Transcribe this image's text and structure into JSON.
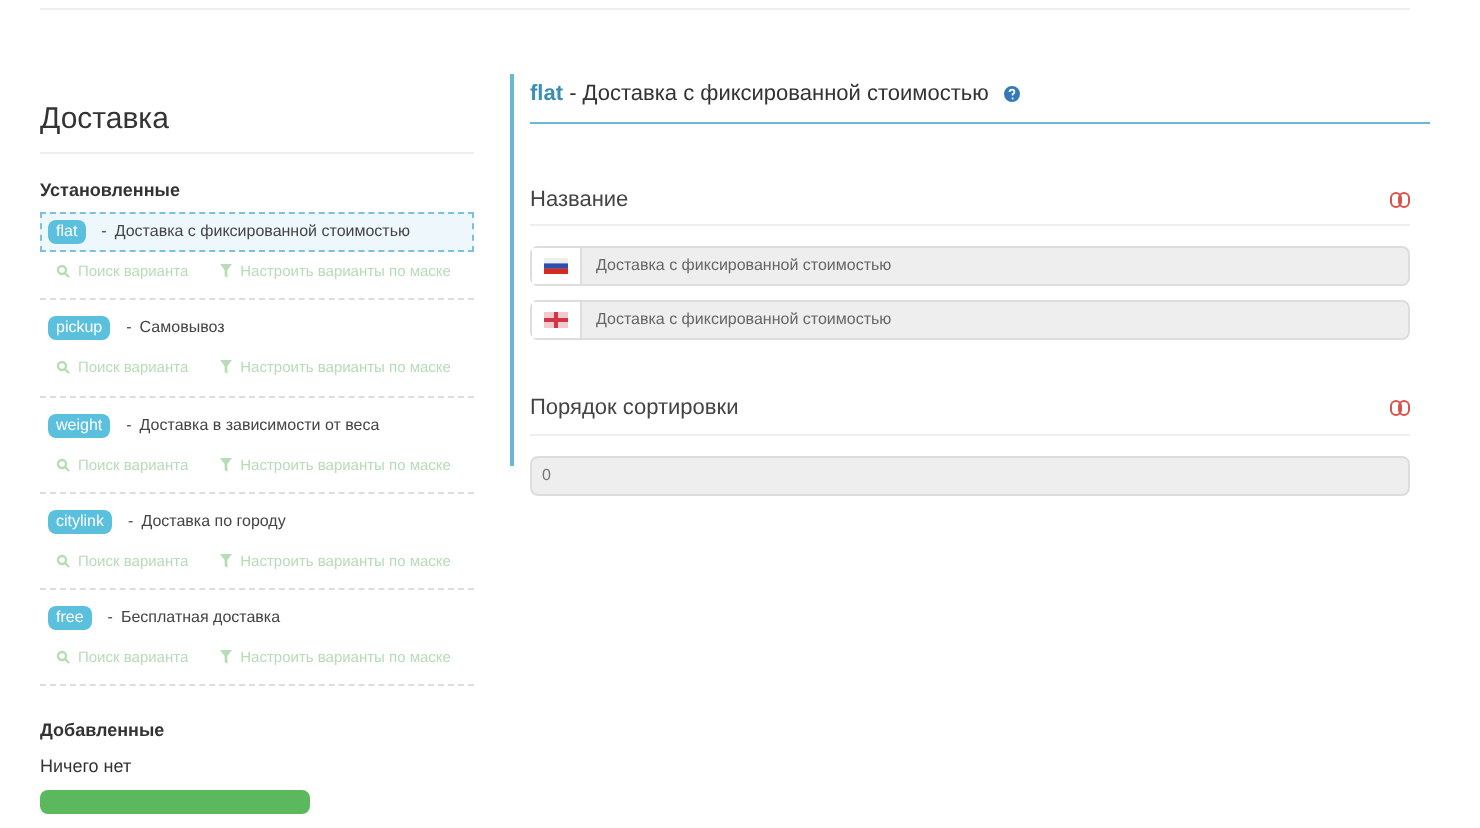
{
  "sidebar": {
    "title": "Доставка",
    "installed": {
      "heading": "Установленные",
      "items": [
        {
          "code": "flat",
          "separator": "-",
          "name": "Доставка с фиксированной стоимостью",
          "selected": true,
          "links": [
            "Поиск варианта",
            "Настроить варианты по маске"
          ]
        },
        {
          "code": "pickup",
          "separator": "-",
          "name": "Самовывоз",
          "selected": false,
          "links": [
            "Поиск варианта",
            "Настроить варианты по маске"
          ]
        },
        {
          "code": "weight",
          "separator": "-",
          "name": "Доставка в зависимости от веса",
          "selected": false,
          "links": [
            "Поиск варианта",
            "Настроить варианты по маске"
          ]
        },
        {
          "code": "citylink",
          "separator": "-",
          "name": "Доставка по городу",
          "selected": false,
          "links": [
            "Поиск варианта",
            "Настроить варианты по маске"
          ]
        },
        {
          "code": "free",
          "separator": "-",
          "name": "Бесплатная доставка",
          "selected": false,
          "links": [
            "Поиск варианта",
            "Настроить варианты по маске"
          ]
        }
      ]
    },
    "added": {
      "heading": "Добавленные",
      "empty_text": "Ничего нет"
    }
  },
  "panel": {
    "code": "flat",
    "separator": "-",
    "title": "Доставка с фиксированной стоимостью",
    "sections": [
      {
        "label": "Название",
        "fields": [
          {
            "kind": "ru",
            "value": "Доставка с фиксированной стоимостью"
          },
          {
            "kind": "gb",
            "value": "Доставка с фиксированной стоимостью"
          }
        ]
      },
      {
        "label": "Порядок сортировки",
        "fields": [
          {
            "kind": "plain",
            "value": "0"
          }
        ]
      }
    ]
  }
}
